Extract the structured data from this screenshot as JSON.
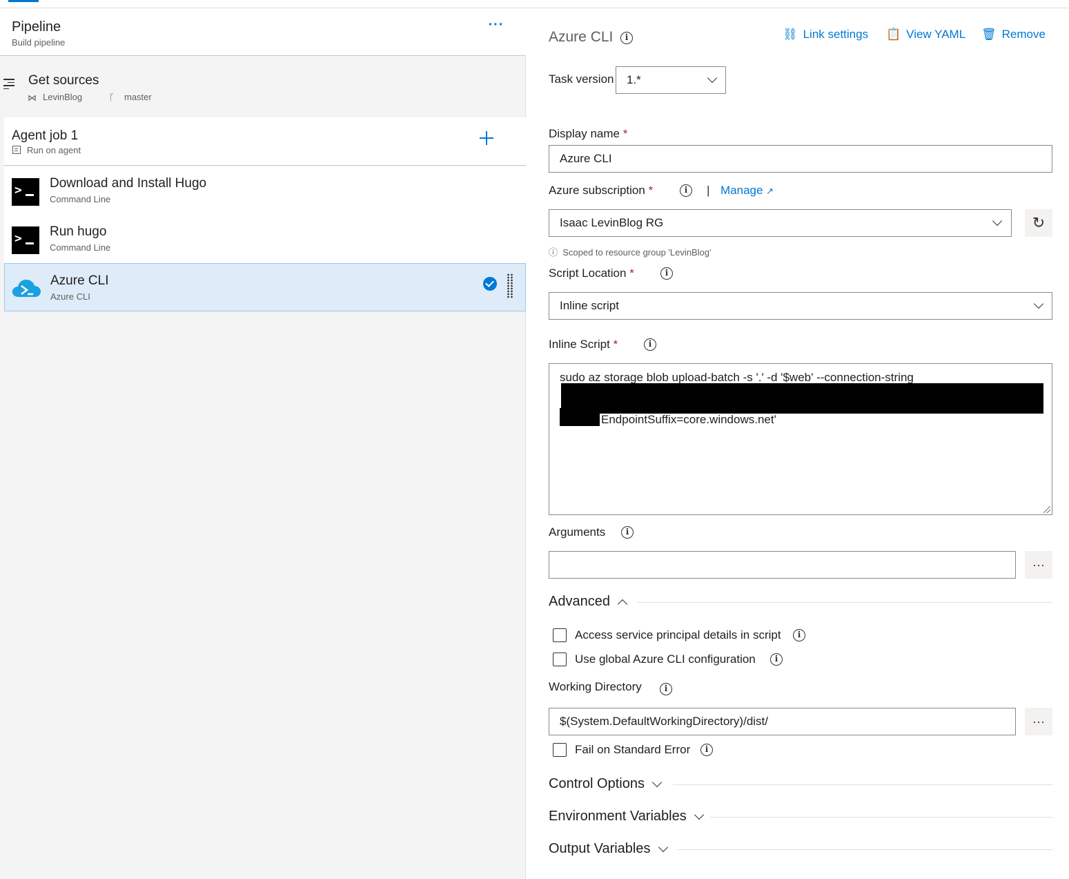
{
  "left": {
    "pipeline": {
      "title": "Pipeline",
      "subtitle": "Build pipeline",
      "more": "···"
    },
    "sources": {
      "title": "Get sources",
      "repo": "LevinBlog",
      "branch": "master"
    },
    "job": {
      "title": "Agent job 1",
      "subtitle": "Run on agent"
    },
    "tasks": [
      {
        "title": "Download and Install Hugo",
        "subtitle": "Command Line"
      },
      {
        "title": "Run hugo",
        "subtitle": "Command Line"
      },
      {
        "title": "Azure CLI",
        "subtitle": "Azure CLI"
      }
    ]
  },
  "right": {
    "title": "Azure CLI",
    "header_actions": {
      "link_settings": "Link settings",
      "view_yaml": "View YAML",
      "remove": "Remove"
    },
    "task_version": {
      "label": "Task version",
      "value": "1.*"
    },
    "display_name": {
      "label": "Display name",
      "required": "*",
      "value": "Azure CLI"
    },
    "azure_subscription": {
      "label": "Azure subscription",
      "required": "*",
      "manage": "Manage",
      "separator": "|",
      "value": "Isaac LevinBlog RG",
      "hint": "Scoped to resource group 'LevinBlog'"
    },
    "script_location": {
      "label": "Script Location",
      "required": "*",
      "value": "Inline script"
    },
    "inline_script": {
      "label": "Inline Script",
      "required": "*",
      "line1": "sudo az storage blob upload-batch -s '.' -d '$web' --connection-string",
      "line3": "EndpointSuffix=core.windows.net'"
    },
    "arguments": {
      "label": "Arguments",
      "value": "",
      "browse": "···"
    },
    "advanced": {
      "label": "Advanced"
    },
    "checkboxes": {
      "access_sp": "Access service principal details in script",
      "global_cli": "Use global Azure CLI configuration",
      "fail_stderr": "Fail on Standard Error"
    },
    "working_directory": {
      "label": "Working Directory",
      "value": "$(System.DefaultWorkingDirectory)/dist/",
      "browse": "···"
    },
    "sections": {
      "control_options": "Control Options",
      "environment_variables": "Environment Variables",
      "output_variables": "Output Variables"
    }
  }
}
